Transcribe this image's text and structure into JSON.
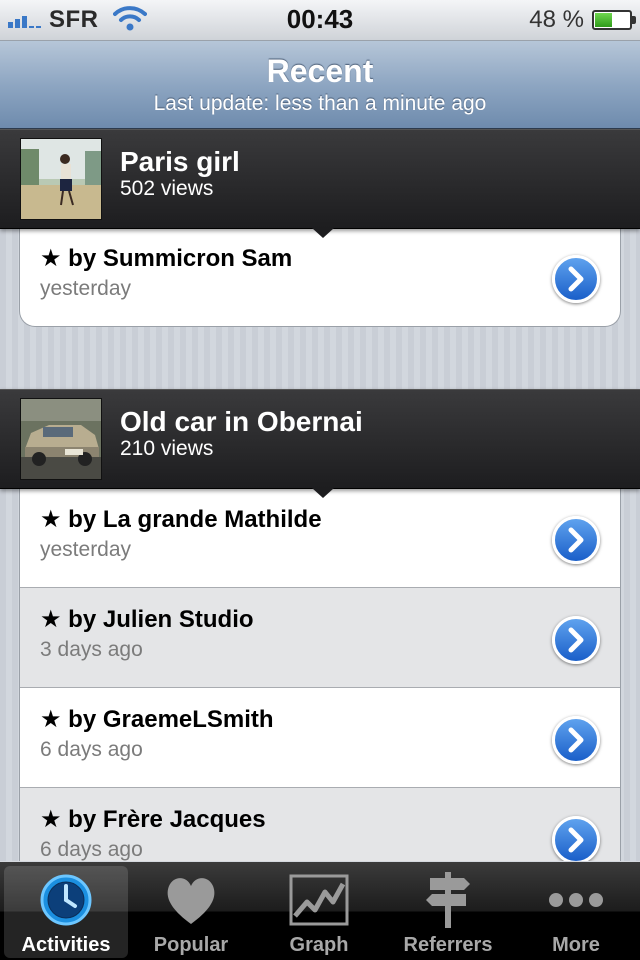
{
  "status_bar": {
    "carrier": "SFR",
    "time": "00:43",
    "battery_percent": "48 %",
    "battery_level": 0.48
  },
  "nav": {
    "title": "Recent",
    "subtitle": "Last update: less than a minute ago"
  },
  "sections": [
    {
      "photo_title": "Paris girl",
      "views": "502 views",
      "items": [
        {
          "who": "★ by Summicron Sam",
          "when": "yesterday"
        }
      ]
    },
    {
      "photo_title": "Old car in Obernai",
      "views": "210 views",
      "items": [
        {
          "who": "★ by La grande Mathilde",
          "when": "yesterday"
        },
        {
          "who": "★ by Julien Studio",
          "when": "3 days ago"
        },
        {
          "who": "★ by GraemeLSmith",
          "when": "6 days ago"
        },
        {
          "who": "★ by Frère Jacques",
          "when": "6 days ago"
        }
      ]
    }
  ],
  "tabs": [
    {
      "label": "Activities",
      "icon": "clock-icon",
      "selected": true
    },
    {
      "label": "Popular",
      "icon": "heart-icon",
      "selected": false
    },
    {
      "label": "Graph",
      "icon": "graph-icon",
      "selected": false
    },
    {
      "label": "Referrers",
      "icon": "signpost-icon",
      "selected": false
    },
    {
      "label": "More",
      "icon": "more-dots-icon",
      "selected": false
    }
  ],
  "colors": {
    "accent": "#3a78c7",
    "disclosure": "#1a5fc9",
    "section_header": "#1d1d1f"
  }
}
